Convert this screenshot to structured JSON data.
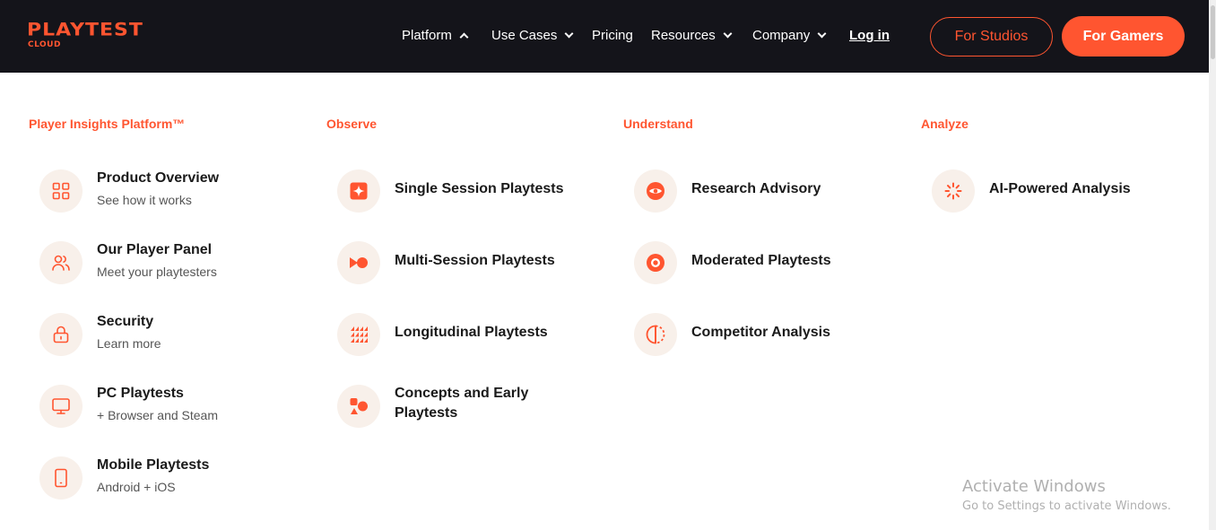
{
  "brand": {
    "word": "PLAYTEST",
    "sub": "CLOUD",
    "color": "#ff5530"
  },
  "nav": {
    "platform": "Platform",
    "use_cases": "Use Cases",
    "pricing": "Pricing",
    "resources": "Resources",
    "company": "Company",
    "login": "Log in"
  },
  "buttons": {
    "studios": "For Studios",
    "gamers": "For Gamers"
  },
  "columns": {
    "insights": {
      "heading": "Player Insights Platform™",
      "items": [
        {
          "title": "Product Overview",
          "subtitle": "See how it works",
          "icon": "grid-icon"
        },
        {
          "title": "Our Player Panel",
          "subtitle": "Meet your playtesters",
          "icon": "users-icon"
        },
        {
          "title": "Security",
          "subtitle": "Learn more",
          "icon": "lock-icon"
        },
        {
          "title": "PC Playtests",
          "subtitle": "+ Browser and Steam",
          "icon": "monitor-icon"
        },
        {
          "title": "Mobile Playtests",
          "subtitle": "Android + iOS",
          "icon": "phone-icon"
        }
      ]
    },
    "observe": {
      "heading": "Observe",
      "items": [
        {
          "title": "Single Session Playtests",
          "icon": "spark-icon"
        },
        {
          "title": "Multi-Session Playtests",
          "icon": "video-icon"
        },
        {
          "title": "Longitudinal Playtests",
          "icon": "triangles-icon"
        },
        {
          "title": "Concepts and Early",
          "title2": "Playtests",
          "icon": "shapes-icon"
        }
      ]
    },
    "understand": {
      "heading": "Understand",
      "items": [
        {
          "title": "Research Advisory",
          "icon": "eye-icon"
        },
        {
          "title": "Moderated Playtests",
          "icon": "target-icon"
        },
        {
          "title": "Competitor Analysis",
          "icon": "half-circle-icon"
        }
      ]
    },
    "analyze": {
      "heading": "Analyze",
      "items": [
        {
          "title": "AI-Powered Analysis",
          "icon": "loader-icon"
        }
      ]
    }
  },
  "watermark": {
    "line1": "Activate Windows",
    "line2": "Go to Settings to activate Windows."
  }
}
